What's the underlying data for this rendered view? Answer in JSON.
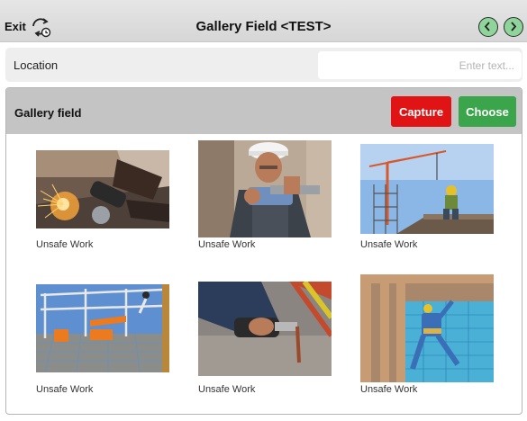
{
  "header": {
    "exit_label": "Exit",
    "title": "Gallery Field <TEST>",
    "exit_icon": "sync-exit-icon",
    "prev_icon": "chevron-left-icon",
    "next_icon": "chevron-right-icon",
    "nav_color": "#8fd49a"
  },
  "location": {
    "label": "Location",
    "placeholder": "Enter text...",
    "value": ""
  },
  "gallery": {
    "title": "Gallery field",
    "capture_label": "Capture",
    "choose_label": "Choose",
    "capture_color": "#e01414",
    "choose_color": "#3aa54a",
    "items": [
      {
        "label": "Unsafe Work"
      },
      {
        "label": "Unsafe Work"
      },
      {
        "label": "Unsafe Work"
      },
      {
        "label": "Unsafe Work"
      },
      {
        "label": "Unsafe Work"
      },
      {
        "label": "Unsafe Work"
      }
    ]
  }
}
